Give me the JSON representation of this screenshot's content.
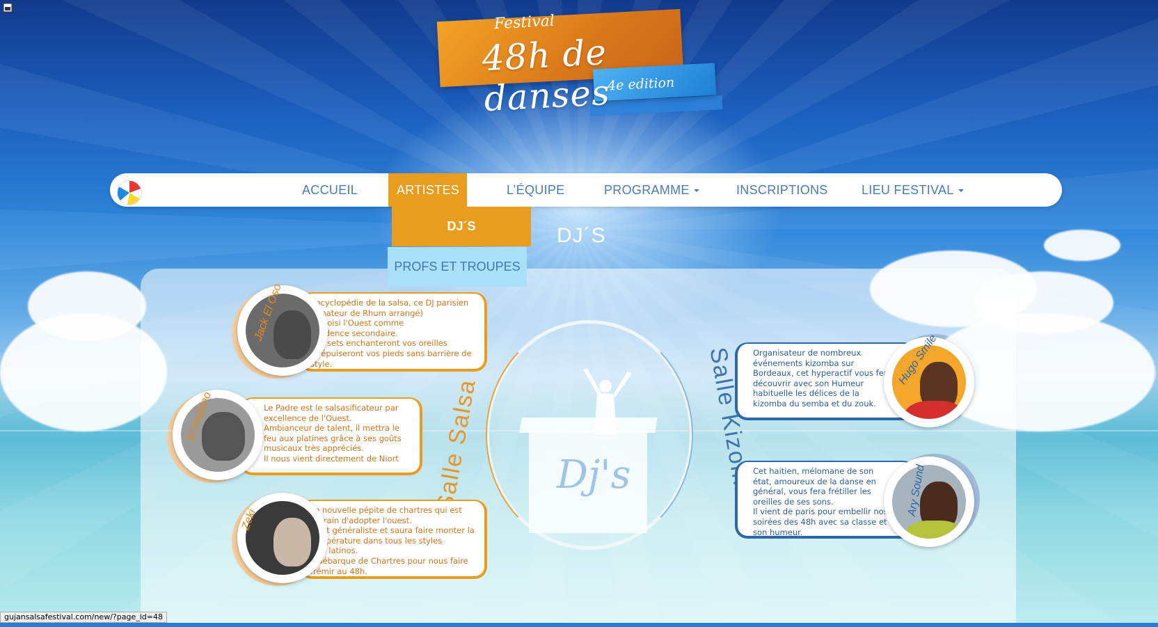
{
  "logo": {
    "line1": "Festival",
    "line2": "48h de danses",
    "line3": "4e edition"
  },
  "nav": {
    "items": [
      {
        "label": "ACCUEIL",
        "dropdown": false,
        "active": false
      },
      {
        "label": "ARTISTES",
        "dropdown": true,
        "active": true
      },
      {
        "label": "L’ÉQUIPE",
        "dropdown": false,
        "active": false
      },
      {
        "label": "PROGRAMME",
        "dropdown": true,
        "active": false
      },
      {
        "label": "INSCRIPTIONS",
        "dropdown": false,
        "active": false
      },
      {
        "label": "LIEU FESTIVAL",
        "dropdown": true,
        "active": false
      }
    ],
    "submenu": [
      "DJ´S",
      "PROFS ET TROUPES"
    ]
  },
  "page_title": "DJ´S",
  "center": {
    "booth_text": "Dj's",
    "salle_left": "Salle Salsa",
    "salle_right": "Salle Kizomba"
  },
  "artists_left": [
    {
      "name": "Jack El Oso",
      "text": "Encyclopédie de la salsa, ce DJ parisien (amateur de Rhum arrangé)\na choisi l'Ouest comme\nrésidence secondaire.\nSes sets enchanteront vos oreilles\net épuiseront vos pieds sans barrière de style."
    },
    {
      "name": "El Padrino",
      "text": "Le Padre est le salsasificateur par excellence de l'Ouest.\nAmbianceur de talent, il mettra le feu aux platines grâce à ses goûts musicaux très appréciés.\nIl nous vient directement de Niort"
    },
    {
      "name": "Zeki",
      "text": "Le nouvelle pépite de chartres qui est entrain d'adopter  l'ouest.\nIl est généraliste et saura faire monter la température dans tous les styles\nafro latinos.\nIl débarque de Chartres pour nous faire frémir au 48h."
    }
  ],
  "artists_right": [
    {
      "name": "Hugo Smile",
      "text": "Organisateur de nombreux événements kizomba sur Bordeaux, cet hyperactif vous fera découvrir avec son Humeur habituelle les délices de la kizomba du semba et du zouk."
    },
    {
      "name": "Ary Sound",
      "text": "Cet haitien, mélomane de son état, amoureux de la danse en général, vous fera frétiller les oreilles de ses sons.\nIl vient de paris pour embellir nos soirées des 48h avec sa classe et son humeur."
    }
  ],
  "status_bar": "gujansalsafestival.com/new/?page_id=48",
  "colors": {
    "orange": "#e89d1f",
    "blue_text": "#4a7cb2",
    "dark_blue": "#2e67a8",
    "light_blue": "#a9e0f7"
  }
}
